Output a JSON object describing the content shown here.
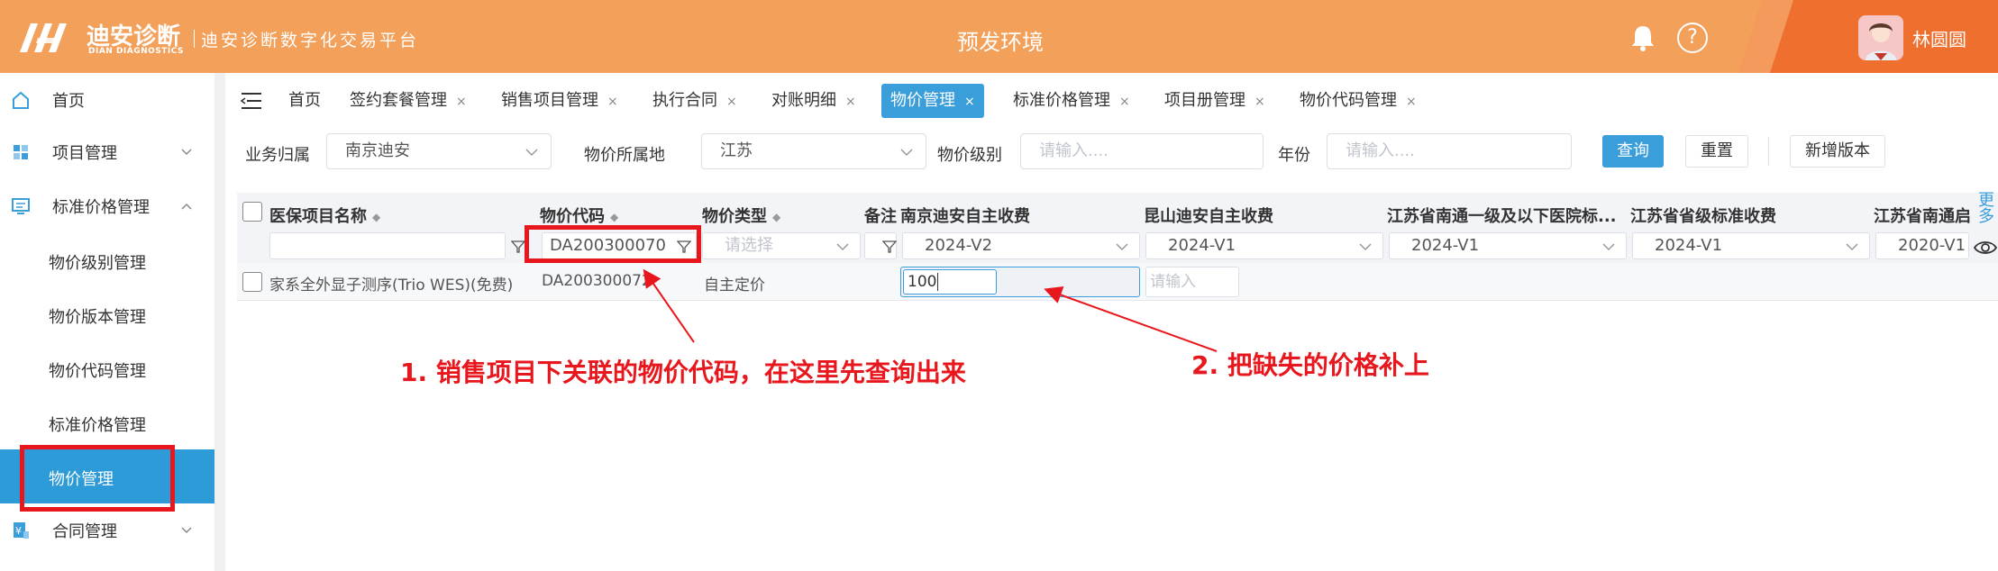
{
  "header": {
    "logo_text": "迪安诊断",
    "logo_en": "DIAN DIAGNOSTICS",
    "platform": "迪安诊断数字化交易平台",
    "env": "预发环境",
    "user": "林圆圆",
    "colors": {
      "header_bg": "#f2a05a",
      "user_bg": "#ee6f2e",
      "accent": "#3a9edb",
      "annotation": "#e8171d"
    }
  },
  "sidebar": {
    "home": "首页",
    "project": "项目管理",
    "standard_price": "标准价格管理",
    "subitems": [
      "物价级别管理",
      "物价版本管理",
      "物价代码管理",
      "标准价格管理",
      "物价管理"
    ],
    "contract": "合同管理",
    "active": "物价管理"
  },
  "tabs": {
    "items": [
      "首页",
      "签约套餐管理",
      "销售项目管理",
      "执行合同",
      "对账明细",
      "物价管理",
      "标准价格管理",
      "项目册管理",
      "物价代码管理"
    ],
    "close": "×",
    "active": "物价管理"
  },
  "filters": {
    "business_label": "业务归属",
    "business_value": "南京迪安",
    "region_label": "物价所属地",
    "region_value": "江苏",
    "level_label": "物价级别",
    "level_placeholder": "请输入....",
    "year_label": "年份",
    "year_placeholder": "请输入....",
    "query_btn": "查询",
    "reset_btn": "重置",
    "new_version_btn": "新增版本"
  },
  "table": {
    "headers": {
      "name": "医保项目名称",
      "code": "物价代码",
      "type": "物价类型",
      "remark": "备注",
      "nanjing": "南京迪安自主收费",
      "kunshan": "昆山迪安自主收费",
      "nantong1": "江苏省南通一级及以下医院标...",
      "provincial": "江苏省省级标准收费",
      "nantong2": "江苏省南通启"
    },
    "header_filters": {
      "code": "DA200300070",
      "type_placeholder": "请选择",
      "nanjing": "2024-V2",
      "kunshan": "2024-V1",
      "nantong1": "2024-V1",
      "provincial": "2024-V1",
      "nantong2": "2020-V1"
    },
    "more": "更多",
    "rows": [
      {
        "name": "家系全外显子测序(Trio WES)(免费)",
        "code": "DA200300072",
        "type": "自主定价",
        "nanjing_price": "100",
        "kunshan_placeholder": "请输入"
      }
    ]
  },
  "annotations": {
    "note1": "1. 销售项目下关联的物价代码，在这里先查询出来",
    "note2": "2. 把缺失的价格补上"
  }
}
